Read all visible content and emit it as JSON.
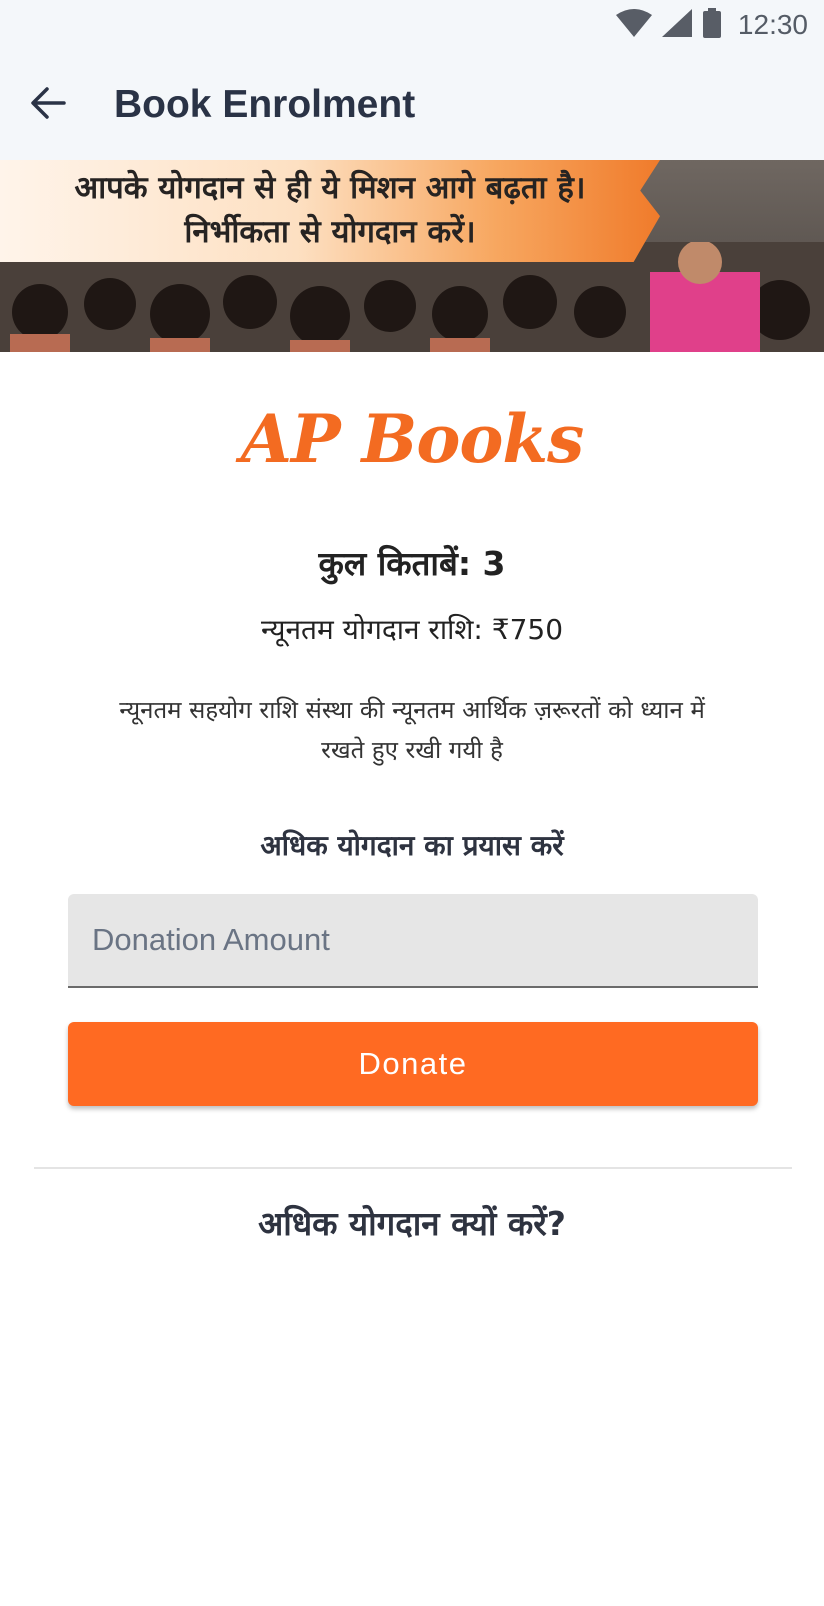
{
  "status_bar": {
    "time": "12:30",
    "icons": [
      "wifi-icon",
      "signal-icon",
      "battery-icon"
    ]
  },
  "app_bar": {
    "title": "Book Enrolment",
    "back_icon": "arrow-left-icon"
  },
  "banner": {
    "line1": "आपके योगदान से ही ये मिशन आगे बढ़ता है।",
    "line2": "निर्भीकता से योगदान करें।"
  },
  "content": {
    "brand": "AP Books",
    "total_books": "कुल किताबें: 3",
    "min_amount": "न्यूनतम योगदान राशि: ₹750",
    "note": "न्यूनतम सहयोग राशि संस्था की न्यूनतम आर्थिक ज़रूरतों को ध्यान में रखते हुए रखी गयी है",
    "prompt": "अधिक योगदान का प्रयास करें",
    "donation_placeholder": "Donation Amount",
    "donation_value": "",
    "donate_label": "Donate",
    "why_heading": "अधिक योगदान क्यों करें?"
  },
  "colors": {
    "accent": "#ff6a22",
    "brand": "#f36b21",
    "app_bar_bg": "#f4f7fa",
    "title_text": "#2a3346"
  }
}
